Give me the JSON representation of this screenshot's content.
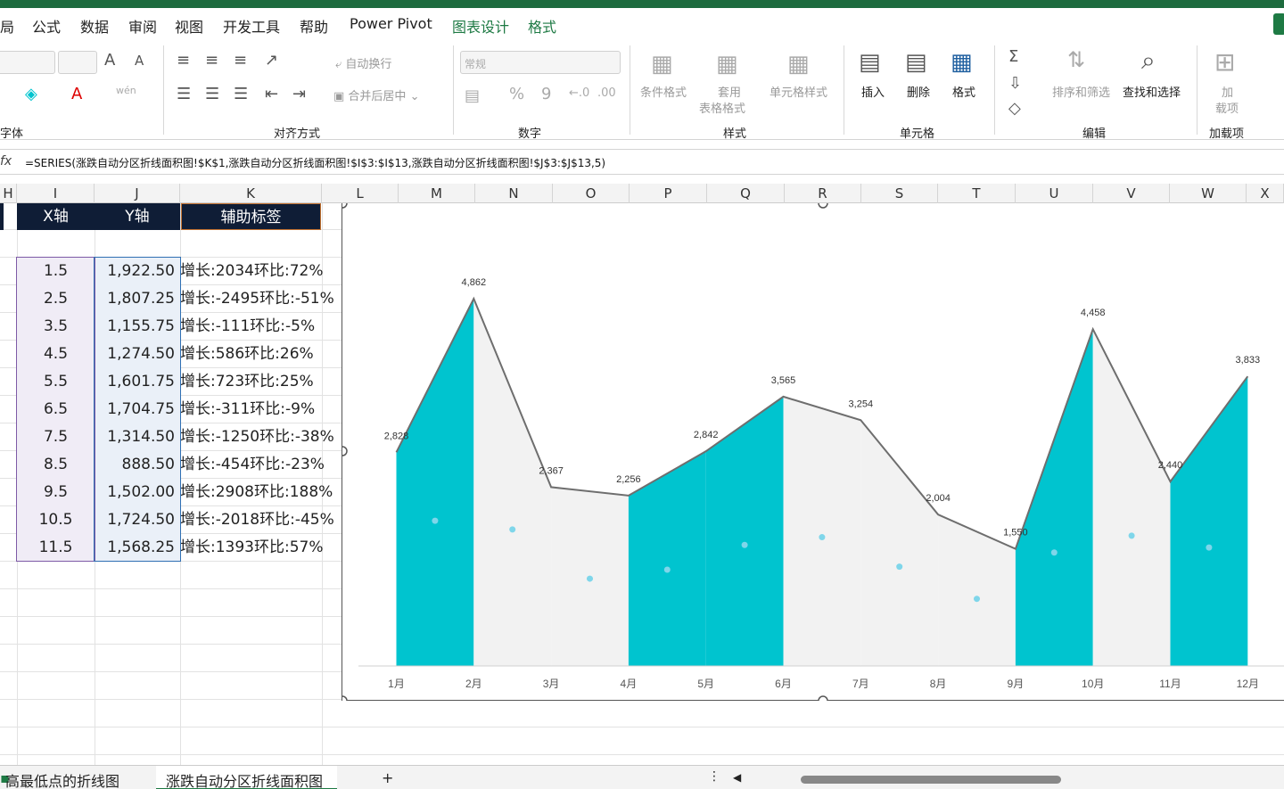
{
  "tabs": [
    {
      "label": "局",
      "green": false
    },
    {
      "label": "公式",
      "green": false
    },
    {
      "label": "数据",
      "green": false
    },
    {
      "label": "审阅",
      "green": false
    },
    {
      "label": "视图",
      "green": false
    },
    {
      "label": "开发工具",
      "green": false
    },
    {
      "label": "帮助",
      "green": false
    },
    {
      "label": "Power Pivot",
      "green": false
    },
    {
      "label": "图表设计",
      "green": true
    },
    {
      "label": "格式",
      "green": true
    }
  ],
  "ribbon": {
    "font_group": "字体",
    "font_grow": "A",
    "font_shrink": "A",
    "align_group": "对齐方式",
    "wrap_text": "自动换行",
    "merge_center": "合并后居中",
    "number_group": "数字",
    "number_format": "常规",
    "percent": "%",
    "comma": "9",
    "style_group": "样式",
    "cond_format": "条件格式",
    "table_format_1": "套用",
    "table_format_2": "表格格式",
    "cell_style": "单元格样式",
    "cells_group": "单元格",
    "insert": "插入",
    "delete": "删除",
    "format": "格式",
    "edit_group": "编辑",
    "sort_filter": "排序和筛选",
    "find_select": "查找和选择",
    "addin_1": "加",
    "addin_2": "载项",
    "addin_group": "加载项"
  },
  "formula_bar": {
    "fx": "fx",
    "formula": "=SERIES(涨跌自动分区折线面积图!$K$1,涨跌自动分区折线面积图!$I$3:$I$13,涨跌自动分区折线面积图!$J$3:$J$13,5)"
  },
  "columns": [
    "H",
    "I",
    "J",
    "K",
    "L",
    "M",
    "N",
    "O",
    "P",
    "Q",
    "R",
    "S",
    "T",
    "U",
    "V",
    "W",
    "X"
  ],
  "table": {
    "headers": {
      "x": "X轴",
      "y": "Y轴",
      "label": "辅助标签"
    },
    "rows": [
      {
        "x": "1.5",
        "y": "1,922.50",
        "label": "增长:2034环比:72%"
      },
      {
        "x": "2.5",
        "y": "1,807.25",
        "label": "增长:-2495环比:-51%"
      },
      {
        "x": "3.5",
        "y": "1,155.75",
        "label": "增长:-111环比:-5%"
      },
      {
        "x": "4.5",
        "y": "1,274.50",
        "label": "增长:586环比:26%"
      },
      {
        "x": "5.5",
        "y": "1,601.75",
        "label": "增长:723环比:25%"
      },
      {
        "x": "6.5",
        "y": "1,704.75",
        "label": "增长:-311环比:-9%"
      },
      {
        "x": "7.5",
        "y": "1,314.50",
        "label": "增长:-1250环比:-38%"
      },
      {
        "x": "8.5",
        "y": "888.50",
        "label": "增长:-454环比:-23%"
      },
      {
        "x": "9.5",
        "y": "1,502.00",
        "label": "增长:2908环比:188%"
      },
      {
        "x": "10.5",
        "y": "1,724.50",
        "label": "增长:-2018环比:-45%"
      },
      {
        "x": "11.5",
        "y": "1,568.25",
        "label": "增长:1393环比:57%"
      }
    ]
  },
  "chart_data": {
    "type": "area",
    "categories": [
      "1月",
      "2月",
      "3月",
      "4月",
      "5月",
      "6月",
      "7月",
      "8月",
      "9月",
      "10月",
      "11月",
      "12月"
    ],
    "series": [
      {
        "values": [
          2828,
          4862,
          2367,
          2256,
          2842,
          3565,
          3254,
          2004,
          1550,
          4458,
          2440,
          3833
        ]
      }
    ],
    "helper_points": {
      "x": [
        1.5,
        2.5,
        3.5,
        4.5,
        5.5,
        6.5,
        7.5,
        8.5,
        9.5,
        10.5,
        11.5
      ],
      "y": [
        1922.5,
        1807.25,
        1155.75,
        1274.5,
        1601.75,
        1704.75,
        1314.5,
        888.5,
        1502,
        1724.5,
        1568.25
      ]
    },
    "ylim": [
      0,
      5000
    ],
    "colors": {
      "rise": "#00c4cf",
      "fall": "#f2f2f2",
      "line": "#6e6e6e",
      "point": "#7fd6ea"
    }
  },
  "sheet_tabs": {
    "prev": "高最低点的折线图",
    "active": "涨跌自动分区折线面积图",
    "add": "+"
  }
}
